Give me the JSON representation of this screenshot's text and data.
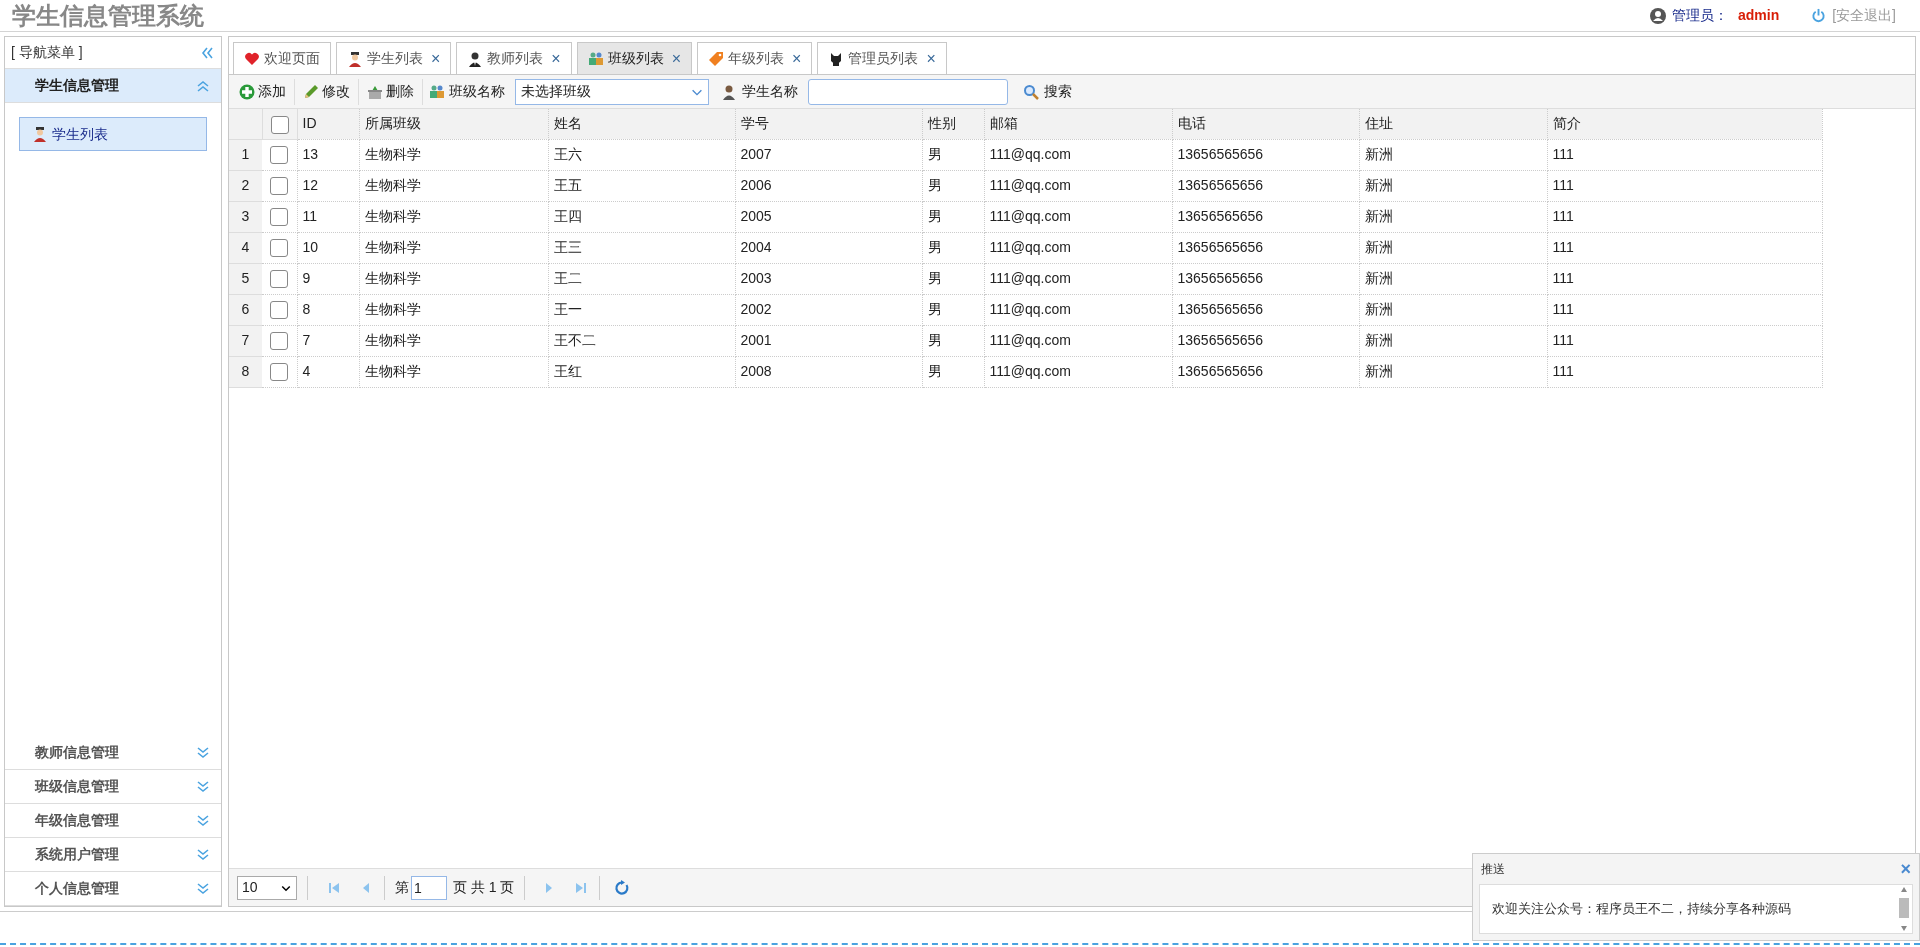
{
  "header": {
    "title": "学生信息管理系统",
    "user_label": "管理员：",
    "user_name": "admin",
    "logout": "[安全退出]"
  },
  "sidebar": {
    "title": "[ 导航菜单 ]",
    "panels": [
      {
        "label": "学生信息管理",
        "expanded": true,
        "items": [
          {
            "label": "学生列表",
            "selected": true
          }
        ]
      },
      {
        "label": "教师信息管理",
        "expanded": false
      },
      {
        "label": "班级信息管理",
        "expanded": false
      },
      {
        "label": "年级信息管理",
        "expanded": false
      },
      {
        "label": "系统用户管理",
        "expanded": false
      },
      {
        "label": "个人信息管理",
        "expanded": false
      }
    ]
  },
  "tabs": [
    {
      "label": "欢迎页面",
      "closable": false,
      "selected": false
    },
    {
      "label": "学生列表",
      "closable": true,
      "selected": false
    },
    {
      "label": "教师列表",
      "closable": true,
      "selected": false
    },
    {
      "label": "班级列表",
      "closable": true,
      "selected": true
    },
    {
      "label": "年级列表",
      "closable": true,
      "selected": false
    },
    {
      "label": "管理员列表",
      "closable": true,
      "selected": false
    }
  ],
  "close_glyph": "×",
  "toolbar": {
    "buttons": [
      {
        "label": "添加"
      },
      {
        "label": "修改"
      },
      {
        "label": "删除"
      }
    ],
    "class_label": "班级名称",
    "class_select": "未选择班级",
    "student_label": "学生名称",
    "search": "搜索"
  },
  "table": {
    "all_checked": false,
    "columns": [
      "ID",
      "所属班级",
      "姓名",
      "学号",
      "性别",
      "邮箱",
      "电话",
      "住址",
      "简介"
    ],
    "rows": [
      {
        "n": "1",
        "checked": false,
        "cells": [
          "13",
          "生物科学",
          "王六",
          "2007",
          "男",
          "111@qq.com",
          "13656565656",
          "新洲",
          "111"
        ]
      },
      {
        "n": "2",
        "checked": false,
        "cells": [
          "12",
          "生物科学",
          "王五",
          "2006",
          "男",
          "111@qq.com",
          "13656565656",
          "新洲",
          "111"
        ]
      },
      {
        "n": "3",
        "checked": false,
        "cells": [
          "11",
          "生物科学",
          "王四",
          "2005",
          "男",
          "111@qq.com",
          "13656565656",
          "新洲",
          "111"
        ]
      },
      {
        "n": "4",
        "checked": false,
        "cells": [
          "10",
          "生物科学",
          "王三",
          "2004",
          "男",
          "111@qq.com",
          "13656565656",
          "新洲",
          "111"
        ]
      },
      {
        "n": "5",
        "checked": false,
        "cells": [
          "9",
          "生物科学",
          "王二",
          "2003",
          "男",
          "111@qq.com",
          "13656565656",
          "新洲",
          "111"
        ]
      },
      {
        "n": "6",
        "checked": false,
        "cells": [
          "8",
          "生物科学",
          "王一",
          "2002",
          "男",
          "111@qq.com",
          "13656565656",
          "新洲",
          "111"
        ]
      },
      {
        "n": "7",
        "checked": false,
        "cells": [
          "7",
          "生物科学",
          "王不二",
          "2001",
          "男",
          "111@qq.com",
          "13656565656",
          "新洲",
          "111"
        ]
      },
      {
        "n": "8",
        "checked": false,
        "cells": [
          "4",
          "生物科学",
          "王红",
          "2008",
          "男",
          "111@qq.com",
          "13656565656",
          "新洲",
          "111"
        ]
      }
    ]
  },
  "pager": {
    "page_size": "10",
    "page_prefix": "第",
    "page": "1",
    "page_suffix": "页 共 1 页"
  },
  "popup": {
    "title": "推送",
    "message": "欢迎关注公众号：程序员王不二，持续分享各种源码",
    "close": "×"
  }
}
